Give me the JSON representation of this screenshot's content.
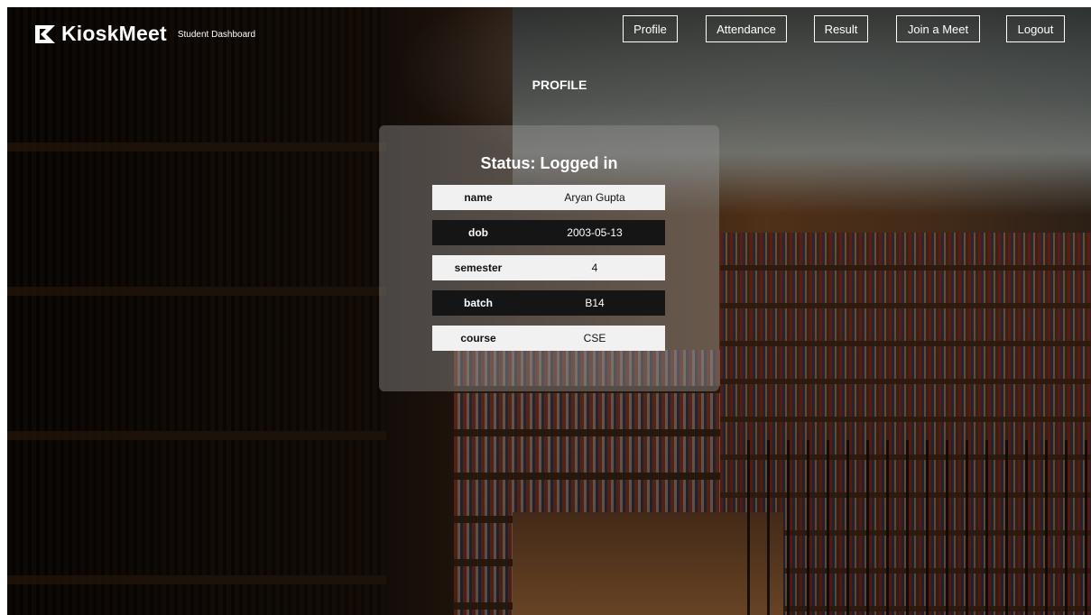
{
  "brand": {
    "name": "KioskMeet",
    "subtitle": "Student Dashboard"
  },
  "nav": {
    "profile": "Profile",
    "attendance": "Attendance",
    "result": "Result",
    "join": "Join a Meet",
    "logout": "Logout"
  },
  "page": {
    "title": "PROFILE"
  },
  "profile": {
    "status": "Status: Logged in",
    "rows": [
      {
        "key": "name",
        "value": "Aryan Gupta"
      },
      {
        "key": "dob",
        "value": "2003-05-13"
      },
      {
        "key": "semester",
        "value": "4"
      },
      {
        "key": "batch",
        "value": "B14"
      },
      {
        "key": "course",
        "value": "CSE"
      }
    ]
  },
  "colors": {
    "nav_border": "#ffffff",
    "row_light": "#f1f1f1",
    "row_dark": "#151515"
  }
}
